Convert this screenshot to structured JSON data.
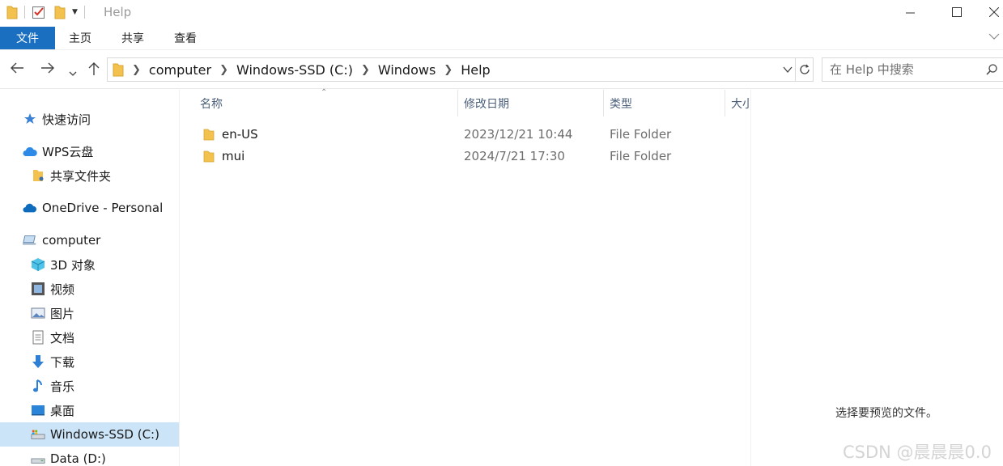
{
  "window": {
    "title": "Help",
    "qa_dropdown_icon": "chevron-down-icon",
    "minimize_icon": "minimize-icon",
    "maximize_icon": "maximize-icon",
    "close_icon": "close-icon"
  },
  "ribbon": {
    "tabs": [
      {
        "label": "文件",
        "active": true
      },
      {
        "label": "主页"
      },
      {
        "label": "共享"
      },
      {
        "label": "查看"
      }
    ],
    "accent": "#1a6fc1"
  },
  "address": {
    "crumbs": [
      "computer",
      "Windows-SSD (C:)",
      "Windows",
      "Help"
    ]
  },
  "search": {
    "placeholder": "在 Help 中搜索"
  },
  "nav": {
    "items": [
      {
        "label": "快速访问",
        "icon": "star-icon"
      },
      {
        "label": "WPS云盘",
        "icon": "cloud-icon"
      },
      {
        "label": "共享文件夹",
        "icon": "shared-folder-icon"
      },
      {
        "label": "OneDrive - Personal",
        "icon": "onedrive-cloud-icon"
      },
      {
        "label": "computer",
        "icon": "computer-icon"
      },
      {
        "label": "3D 对象",
        "icon": "cube-icon"
      },
      {
        "label": "视频",
        "icon": "video-icon"
      },
      {
        "label": "图片",
        "icon": "picture-icon"
      },
      {
        "label": "文档",
        "icon": "document-icon"
      },
      {
        "label": "下载",
        "icon": "download-icon"
      },
      {
        "label": "音乐",
        "icon": "music-icon"
      },
      {
        "label": "桌面",
        "icon": "desktop-icon"
      },
      {
        "label": "Windows-SSD (C:)",
        "icon": "drive-c-icon",
        "selected": true
      },
      {
        "label": "Data (D:)",
        "icon": "drive-d-icon"
      }
    ]
  },
  "columns": {
    "name": "名称",
    "modified": "修改日期",
    "type": "类型",
    "size": "大小"
  },
  "files": [
    {
      "name": "en-US",
      "modified": "2023/12/21 10:44",
      "type": "File Folder"
    },
    {
      "name": "mui",
      "modified": "2024/7/21 17:30",
      "type": "File Folder"
    }
  ],
  "preview": {
    "message": "选择要预览的文件。",
    "watermark": "CSDN @晨晨晨0.0"
  }
}
